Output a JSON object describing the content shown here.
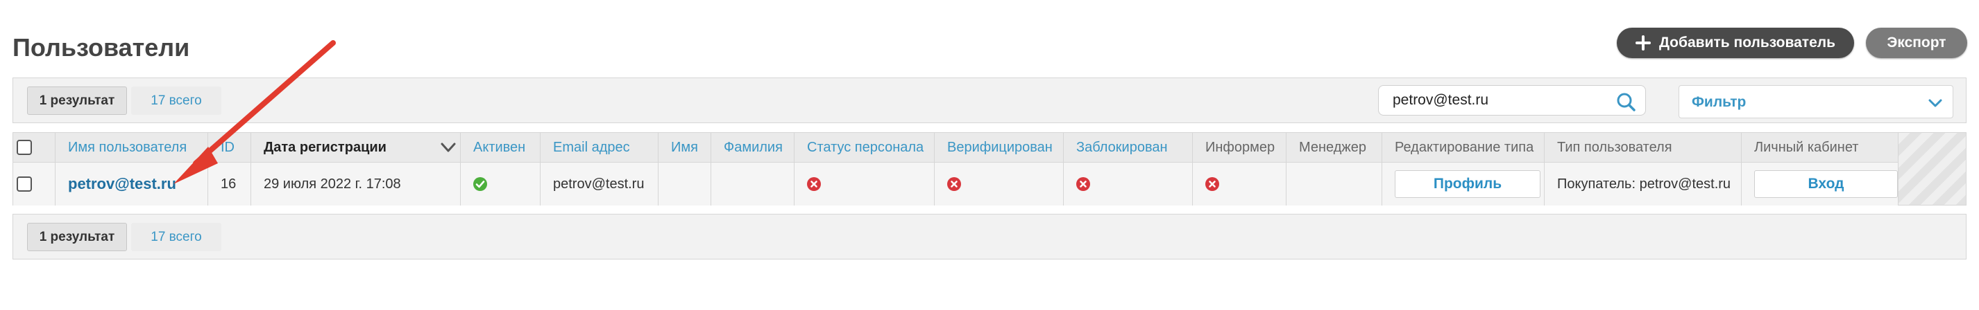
{
  "page": {
    "title": "Пользователи"
  },
  "actions": {
    "add_user": "Добавить пользователь",
    "export": "Экспорт"
  },
  "summary": {
    "result_count": "1 результат",
    "total": "17 всего"
  },
  "search": {
    "value": "petrov@test.ru"
  },
  "filter": {
    "label": "Фильтр"
  },
  "table": {
    "columns": {
      "username": "Имя пользователя",
      "id": "ID",
      "registered": "Дата регистрации",
      "active": "Активен",
      "email": "Email адрес",
      "first_name": "Имя",
      "last_name": "Фамилия",
      "staff_status": "Статус персонала",
      "verified": "Верифицирован",
      "blocked": "Заблокирован",
      "informer": "Информер",
      "manager": "Менеджер",
      "type_edit": "Редактирование типа",
      "user_type": "Тип пользователя",
      "cabinet": "Личный кабинет"
    },
    "rows": [
      {
        "username": "petrov@test.ru",
        "id": "16",
        "registered": "29 июля 2022 г. 17:08",
        "active": true,
        "email": "petrov@test.ru",
        "first_name": "",
        "last_name": "",
        "staff_status": false,
        "verified": false,
        "blocked": false,
        "informer": false,
        "manager": "",
        "type_edit_button": "Профиль",
        "user_type": "Покупатель: petrov@test.ru",
        "cabinet_button": "Вход"
      }
    ]
  },
  "colors": {
    "accent": "#3a96c5",
    "ok": "#4caf3c",
    "error": "#d8373d",
    "arrow": "#e23b2e"
  }
}
